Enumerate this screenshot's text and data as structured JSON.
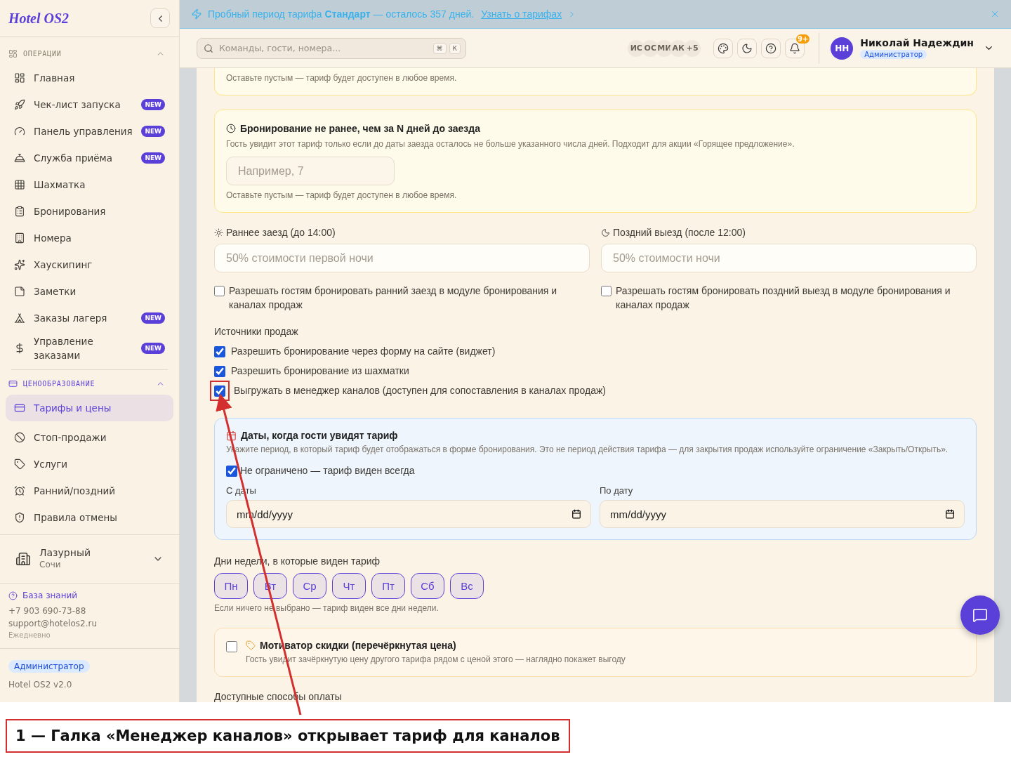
{
  "sidebar": {
    "logo": "Hotel OS2",
    "sections": [
      {
        "title": "ОПЕРАЦИИ",
        "expanded": true,
        "items": [
          {
            "label": "Главная",
            "selected": false
          },
          {
            "label": "Чек-лист запуска",
            "badge": "NEW",
            "selected": false
          },
          {
            "label": "Панель управления",
            "badge": "NEW",
            "selected": false
          },
          {
            "label": "Служба приёма",
            "badge": "NEW",
            "selected": false
          },
          {
            "label": "Шахматка",
            "selected": false
          },
          {
            "label": "Бронирования",
            "selected": false
          },
          {
            "label": "Номера",
            "selected": false
          },
          {
            "label": "Хаускипинг",
            "selected": false
          },
          {
            "label": "Заметки",
            "selected": false
          },
          {
            "label": "Заказы лагеря",
            "badge": "NEW",
            "selected": false
          },
          {
            "label": "Управление заказами",
            "badge": "NEW",
            "selected": false
          }
        ]
      },
      {
        "title": "ЦЕНООБРАЗОВАНИЕ",
        "expanded": true,
        "items": [
          {
            "label": "Тарифы и цены",
            "selected": true
          },
          {
            "label": "Стоп-продажи",
            "selected": false
          },
          {
            "label": "Услуги",
            "selected": false
          },
          {
            "label": "Ранний/поздний",
            "selected": false
          },
          {
            "label": "Правила отмены",
            "selected": false
          }
        ]
      }
    ],
    "hotel": {
      "name": "Лазурный",
      "city": "Сочи"
    },
    "support": {
      "link": "База знаний",
      "phone": "+7 903 690-73-88",
      "email": "support@hotelos2.ru",
      "hours": "Ежедневно"
    },
    "role": "Администратор",
    "version": "Hotel OS2 v2.0"
  },
  "banner": {
    "text": "Пробный период тарифа **Стандарт** — осталось 357 дней.",
    "link": "Узнать о тарифах"
  },
  "header": {
    "search": {
      "placeholder": "Команды, гости, номера...",
      "keys": [
        "⌘",
        "К"
      ]
    },
    "avatars": [
      "ИС",
      "ОС",
      "МИ",
      "АК",
      "+5"
    ],
    "notifications": "9+",
    "user": {
      "initials": "НН",
      "name": "Николай Надеждин",
      "role": "Администратор"
    }
  },
  "content": {
    "top_hint": "Оставьте пустым — тариф будет доступен в любое время.",
    "advance": {
      "title": "Бронирование не ранее, чем за N дней до заезда",
      "description": "Гость увидит этот тариф только если до даты заезда осталось не больше указанного числа дней. Подходит для акции «Горящее предложение».",
      "placeholder": "Например, 7",
      "hint": "Оставьте пустым — тариф будет доступен в любое время."
    },
    "checkin_checkout": [
      {
        "kind": "early",
        "label": "Раннее заезд (до 14:00)",
        "placeholder": "50% стоимости первой ночи",
        "option": "Разрешать гостям бронировать ранний заезд в модуле бронирования и каналах продаж",
        "checked": false
      },
      {
        "kind": "late",
        "label": "Поздний выезд (после 12:00)",
        "placeholder": "50% стоимости ночи",
        "option": "Разрешать гостям бронировать поздний выезд в модуле бронирования и каналах продаж",
        "checked": false
      }
    ],
    "sales_sources": {
      "title": "Источники продаж",
      "options": [
        {
          "label": "Разрешить бронирование через форму на сайте (виджет)",
          "checked": true,
          "annotated": false
        },
        {
          "label": "Разрешить бронирование из шахматки",
          "checked": true,
          "annotated": false
        },
        {
          "label": "Выгружать в менеджер каналов (доступен для сопоставления в каналах продаж)",
          "checked": true,
          "annotated": true
        }
      ]
    },
    "visibility": {
      "title": "Даты, когда гости увидят тариф",
      "description": "Укажите период, в который тариф будет отображаться в форме бронирования. Это не период действия тарифа — для закрытия продаж используйте ограничение «Закрыть/Открыть».",
      "unlimited": {
        "label": "Не ограничено — тариф виден всегда",
        "checked": true
      },
      "fields": [
        {
          "label": "С даты",
          "placeholder": "mm/dd/yyyy"
        },
        {
          "label": "По дату",
          "placeholder": "mm/dd/yyyy"
        }
      ]
    },
    "weekdays": {
      "title": "Дни недели, в которые виден тариф",
      "days": [
        {
          "label": "Пн",
          "selected": false
        },
        {
          "label": "Вт",
          "selected": false
        },
        {
          "label": "Ср",
          "selected": false
        },
        {
          "label": "Чт",
          "selected": false
        },
        {
          "label": "Пт",
          "selected": false
        },
        {
          "label": "Сб",
          "selected": false
        },
        {
          "label": "Вс",
          "selected": false
        }
      ],
      "hint": "Если ничего не выбрано — тариф виден все дни недели."
    },
    "motivator": {
      "title": "Мотиватор скидки (перечёркнутая цена)",
      "description": "Гость увидит зачёркнутую цену другого тарифа рядом с ценой этого — наглядно покажет выгоду",
      "checked": false
    },
    "payments_title": "Доступные способы оплаты"
  },
  "annotation": {
    "caption": "1 — Галка «Менеджер каналов» открывает тариф для каналов"
  }
}
